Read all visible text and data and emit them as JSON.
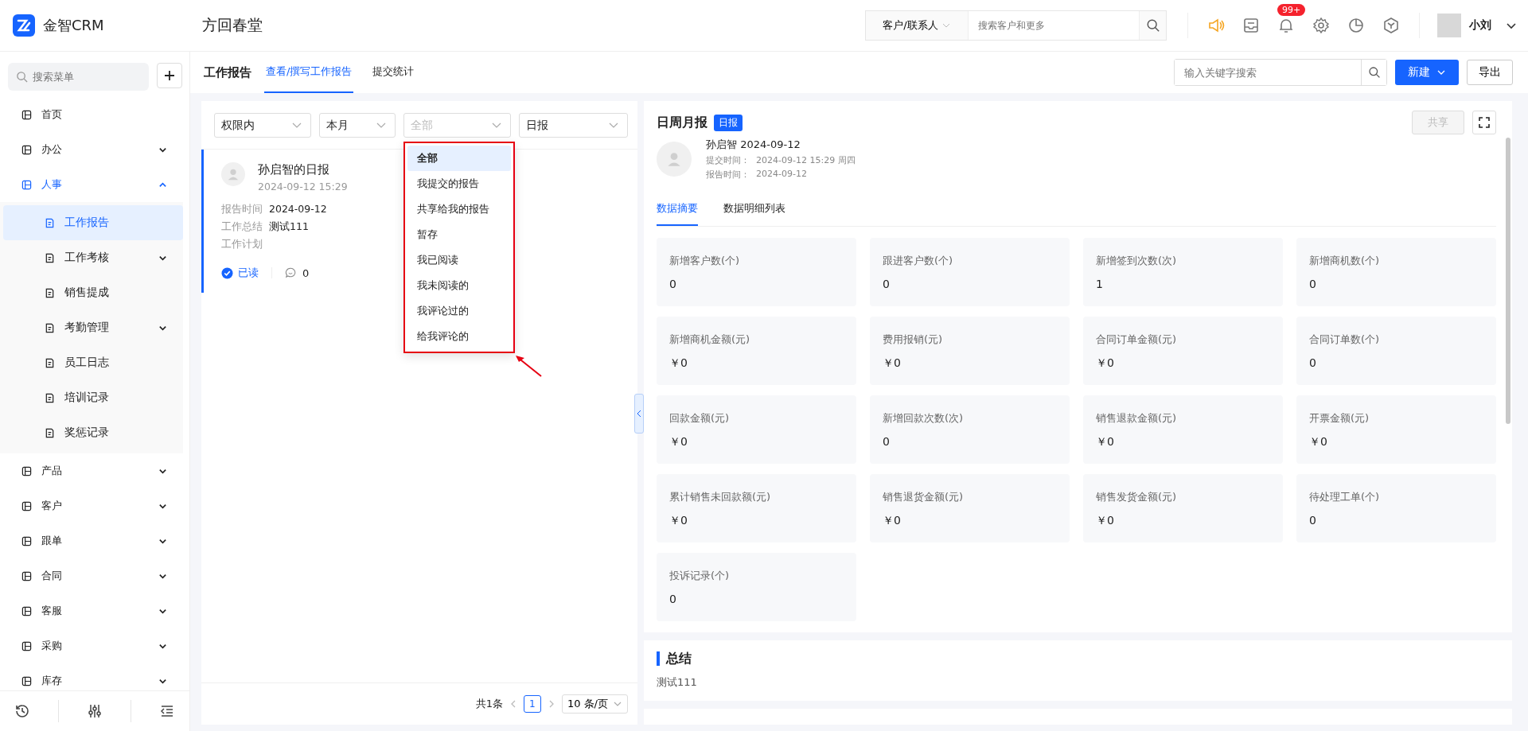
{
  "brand": {
    "name": "金智CRM"
  },
  "company": "方回春堂",
  "global_search": {
    "scope": "客户/联系人",
    "placeholder": "搜索客户和更多"
  },
  "notifications": {
    "badge": "99+"
  },
  "user": {
    "name": "小刘"
  },
  "sidebar": {
    "search_placeholder": "搜索菜单",
    "items": [
      {
        "label": "首页",
        "kind": "page",
        "selected": false
      },
      {
        "label": "办公",
        "kind": "group",
        "expanded": false
      },
      {
        "label": "人事",
        "kind": "group",
        "expanded": true,
        "children": [
          {
            "label": "工作报告",
            "kind": "page",
            "selected": true
          },
          {
            "label": "工作考核",
            "kind": "group",
            "expanded": false
          },
          {
            "label": "销售提成",
            "kind": "page",
            "selected": false
          },
          {
            "label": "考勤管理",
            "kind": "group",
            "expanded": false
          },
          {
            "label": "员工日志",
            "kind": "page",
            "selected": false
          },
          {
            "label": "培训记录",
            "kind": "page",
            "selected": false
          },
          {
            "label": "奖惩记录",
            "kind": "page",
            "selected": false
          }
        ]
      },
      {
        "label": "产品",
        "kind": "group",
        "expanded": false
      },
      {
        "label": "客户",
        "kind": "group",
        "expanded": false
      },
      {
        "label": "跟单",
        "kind": "group",
        "expanded": false
      },
      {
        "label": "合同",
        "kind": "group",
        "expanded": false
      },
      {
        "label": "客服",
        "kind": "group",
        "expanded": false
      },
      {
        "label": "采购",
        "kind": "group",
        "expanded": false
      },
      {
        "label": "库存",
        "kind": "group",
        "expanded": false
      }
    ]
  },
  "page": {
    "title": "工作报告",
    "tabs": [
      {
        "label": "查看/撰写工作报告",
        "selected": true
      },
      {
        "label": "提交统计",
        "selected": false
      }
    ],
    "search_placeholder": "输入关键字搜索",
    "new_button": "新建",
    "export_button": "导出"
  },
  "filters": [
    {
      "value": "权限内"
    },
    {
      "value": "本月"
    },
    {
      "placeholder": "全部"
    },
    {
      "value": "日报"
    }
  ],
  "dropdown": {
    "options": [
      {
        "label": "全部",
        "selected": true
      },
      {
        "label": "我提交的报告",
        "selected": false
      },
      {
        "label": "共享给我的报告",
        "selected": false
      },
      {
        "label": "暂存",
        "selected": false
      },
      {
        "label": "我已阅读",
        "selected": false
      },
      {
        "label": "我未阅读的",
        "selected": false
      },
      {
        "label": "我评论过的",
        "selected": false
      },
      {
        "label": "给我评论的",
        "selected": false
      }
    ]
  },
  "reports": [
    {
      "title": "孙启智的日报",
      "time": "2024-09-12 15:29",
      "selected": true,
      "fields": [
        {
          "label": "报告时间",
          "value": "2024-09-12"
        },
        {
          "label": "工作总结",
          "value": "测试111"
        },
        {
          "label": "工作计划"
        }
      ],
      "read": true,
      "read_label": "已读",
      "comments": "0"
    }
  ],
  "pagination": {
    "total": "共1条",
    "page": "1",
    "page_size": "10 条/页"
  },
  "detail": {
    "title": "日周月报",
    "tag": "日报",
    "share_button": "共享",
    "author_line": "孙启智 2024-09-12",
    "meta": [
      {
        "label": "提交时间：",
        "value": "2024-09-12 15:29 周四"
      },
      {
        "label": "报告时间：",
        "value": "2024-09-12"
      }
    ],
    "tabs": [
      {
        "label": "数据摘要",
        "selected": true
      },
      {
        "label": "数据明细列表",
        "selected": false
      }
    ],
    "stats": [
      {
        "label": "新增客户数(个)",
        "value": "0"
      },
      {
        "label": "跟进客户数(个)",
        "value": "0"
      },
      {
        "label": "新增签到次数(次)",
        "value": "1"
      },
      {
        "label": "新增商机数(个)",
        "value": "0"
      },
      {
        "label": "新增商机金额(元)",
        "value": "￥0"
      },
      {
        "label": "费用报销(元)",
        "value": "￥0"
      },
      {
        "label": "合同订单金额(元)",
        "value": "￥0"
      },
      {
        "label": "合同订单数(个)",
        "value": "0"
      },
      {
        "label": "回款金额(元)",
        "value": "￥0"
      },
      {
        "label": "新增回款次数(次)",
        "value": "0"
      },
      {
        "label": "销售退款金额(元)",
        "value": "￥0"
      },
      {
        "label": "开票金额(元)",
        "value": "￥0"
      },
      {
        "label": "累计销售未回款额(元)",
        "value": "￥0"
      },
      {
        "label": "销售退货金额(元)",
        "value": "￥0"
      },
      {
        "label": "销售发货金额(元)",
        "value": "￥0"
      },
      {
        "label": "待处理工单(个)",
        "value": "0"
      },
      {
        "label": "投诉记录(个)",
        "value": "0"
      }
    ],
    "summary": {
      "title": "总结",
      "text": "测试111"
    }
  }
}
